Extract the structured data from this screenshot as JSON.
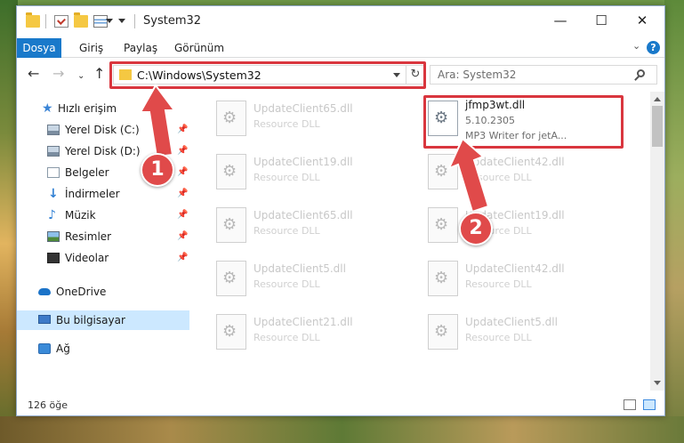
{
  "window": {
    "title": "System32"
  },
  "ribbon": {
    "tabs": [
      "Dosya",
      "Giriş",
      "Paylaş",
      "Görünüm"
    ]
  },
  "address": {
    "path": "C:\\Windows\\System32"
  },
  "search": {
    "placeholder": "Ara: System32"
  },
  "nav_pane": {
    "items": [
      {
        "label": "Hızlı erişim",
        "icon": "star-icon"
      },
      {
        "label": "Yerel Disk (C:)",
        "icon": "drive-icon"
      },
      {
        "label": "Yerel Disk (D:)",
        "icon": "drive-icon"
      },
      {
        "label": "Belgeler",
        "icon": "documents-icon"
      },
      {
        "label": "İndirmeler",
        "icon": "download-icon"
      },
      {
        "label": "Müzik",
        "icon": "music-icon"
      },
      {
        "label": "Resimler",
        "icon": "pictures-icon"
      },
      {
        "label": "Videolar",
        "icon": "videos-icon"
      },
      {
        "label": "OneDrive",
        "icon": "cloud-icon"
      },
      {
        "label": "Bu bilgisayar",
        "icon": "computer-icon"
      },
      {
        "label": "Ağ",
        "icon": "network-icon"
      }
    ]
  },
  "files": {
    "left": [
      {
        "name": "UpdateClient65.dll",
        "desc": "Resource DLL"
      },
      {
        "name": "UpdateClient19.dll",
        "desc": "Resource DLL"
      },
      {
        "name": "UpdateClient65.dll",
        "desc": "Resource DLL"
      },
      {
        "name": "UpdateClient5.dll",
        "desc": "Resource DLL"
      },
      {
        "name": "UpdateClient21.dll",
        "desc": "Resource DLL"
      }
    ],
    "focused": {
      "name": "jfmp3wt.dll",
      "version": "5.10.2305",
      "desc": "MP3 Writer for jetA..."
    },
    "right": [
      {
        "name": "UpdateClient42.dll",
        "desc": "Resource DLL"
      },
      {
        "name": "UpdateClient19.dll",
        "desc": "Resource DLL"
      },
      {
        "name": "UpdateClient42.dll",
        "desc": "Resource DLL"
      },
      {
        "name": "UpdateClient5.dll",
        "desc": "Resource DLL"
      }
    ]
  },
  "status": {
    "item_count": "126 öğe"
  },
  "annotations": {
    "marker1": "1",
    "marker2": "2",
    "color": "#e04a4a"
  },
  "colors": {
    "accent": "#1979ca",
    "selection": "#cce8ff",
    "highlight": "#d9363e"
  }
}
